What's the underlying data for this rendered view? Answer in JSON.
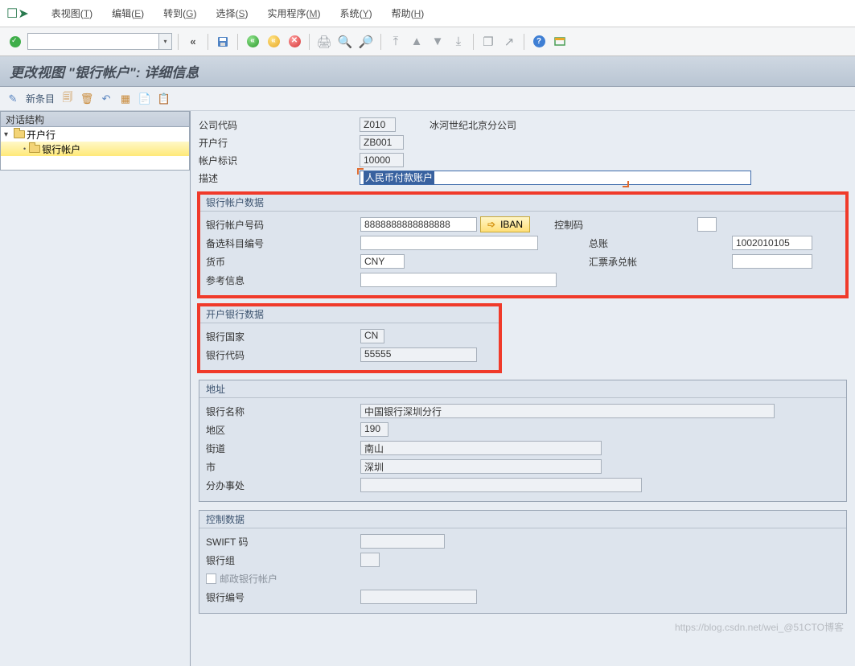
{
  "menubar": {
    "items": [
      {
        "label": "表视图",
        "key": "T"
      },
      {
        "label": "编辑",
        "key": "E"
      },
      {
        "label": "转到",
        "key": "G"
      },
      {
        "label": "选择",
        "key": "S"
      },
      {
        "label": "实用程序",
        "key": "M"
      },
      {
        "label": "系统",
        "key": "Y"
      },
      {
        "label": "帮助",
        "key": "H"
      }
    ]
  },
  "title": "更改视图 \"银行帐户\": 详细信息",
  "apptb": {
    "newentry": "新条目"
  },
  "tree": {
    "header": "对话结构",
    "nodes": [
      {
        "label": "开户行",
        "level": 0,
        "open": true,
        "selected": false
      },
      {
        "label": "银行帐户",
        "level": 1,
        "open": false,
        "selected": true
      }
    ]
  },
  "header_fields": {
    "company_code": {
      "label": "公司代码",
      "value": "Z010",
      "text": "冰河世纪北京分公司"
    },
    "house_bank": {
      "label": "开户行",
      "value": "ZB001"
    },
    "account_id": {
      "label": "帐户标识",
      "value": "10000"
    },
    "description": {
      "label": "描述",
      "value": "人民币付款账户"
    }
  },
  "group_bank_account": {
    "title": "银行帐户数据",
    "account_no": {
      "label": "银行帐户号码",
      "value": "8888888888888888"
    },
    "iban_btn": "IBAN",
    "control_key": {
      "label": "控制码",
      "value": ""
    },
    "alt_account": {
      "label": "备选科目编号",
      "value": ""
    },
    "gl_account": {
      "label": "总账",
      "value": "1002010105"
    },
    "currency": {
      "label": "货币",
      "value": "CNY"
    },
    "discount": {
      "label": "汇票承兑帐",
      "value": ""
    },
    "reference": {
      "label": "参考信息",
      "value": ""
    }
  },
  "group_house_bank": {
    "title": "开户银行数据",
    "country": {
      "label": "银行国家",
      "value": "CN"
    },
    "bank_key": {
      "label": "银行代码",
      "value": "55555"
    }
  },
  "group_address": {
    "title": "地址",
    "bank_name": {
      "label": "银行名称",
      "value": "中国银行深圳分行"
    },
    "region": {
      "label": "地区",
      "value": "190"
    },
    "street": {
      "label": "街道",
      "value": "南山"
    },
    "city": {
      "label": "市",
      "value": "深圳"
    },
    "branch": {
      "label": "分办事处",
      "value": ""
    }
  },
  "group_control": {
    "title": "控制数据",
    "swift": {
      "label": "SWIFT 码",
      "value": ""
    },
    "bank_group": {
      "label": "银行组",
      "value": ""
    },
    "post_bank": {
      "label": "邮政银行帐户",
      "checked": false
    },
    "bank_number": {
      "label": "银行编号",
      "value": ""
    }
  },
  "watermark": "https://blog.csdn.net/wei_@51CTO博客"
}
